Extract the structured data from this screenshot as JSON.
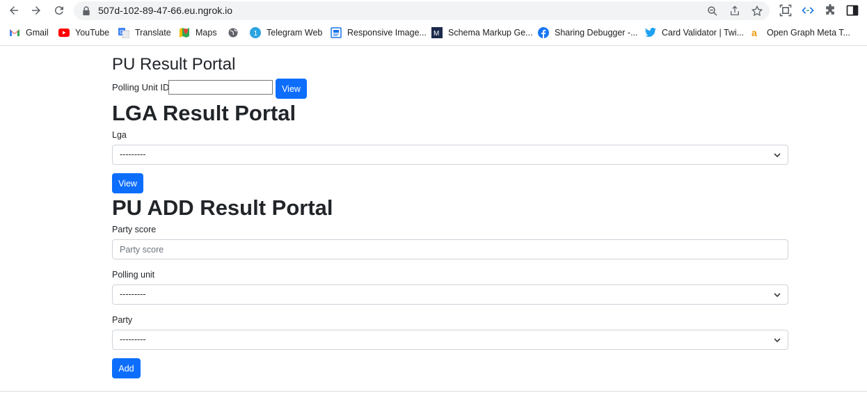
{
  "browser": {
    "url": "507d-102-89-47-66.eu.ngrok.io",
    "bookmarks": [
      {
        "label": "Gmail",
        "icon": "gmail-icon"
      },
      {
        "label": "YouTube",
        "icon": "youtube-icon"
      },
      {
        "label": "Translate",
        "icon": "translate-icon"
      },
      {
        "label": "Maps",
        "icon": "maps-icon"
      },
      {
        "label": "",
        "icon": "globe-icon"
      },
      {
        "label": "Telegram Web",
        "icon": "telegram-icon"
      },
      {
        "label": "Responsive Image...",
        "icon": "responsive-image-icon"
      },
      {
        "label": "Schema Markup Ge...",
        "icon": "schema-markup-icon"
      },
      {
        "label": "Sharing Debugger -...",
        "icon": "facebook-icon"
      },
      {
        "label": "Card Validator | Twi...",
        "icon": "twitter-icon"
      },
      {
        "label": "Open Graph Meta T...",
        "icon": "open-graph-icon"
      }
    ]
  },
  "pu_portal": {
    "title": "PU Result Portal",
    "label": "Polling Unit ID:",
    "value": "",
    "button": "View"
  },
  "lga_portal": {
    "title": "LGA Result Portal",
    "lga_label": "Lga",
    "lga_selected": "---------",
    "button": "View"
  },
  "pu_add_portal": {
    "title": "PU ADD Result Portal",
    "party_score_label": "Party score",
    "party_score_placeholder": "Party score",
    "polling_unit_label": "Polling unit",
    "polling_unit_selected": "---------",
    "party_label": "Party",
    "party_selected": "---------",
    "button": "Add"
  },
  "colors": {
    "primary": "#0d6efd",
    "text": "#212529",
    "border": "#ced4da"
  }
}
